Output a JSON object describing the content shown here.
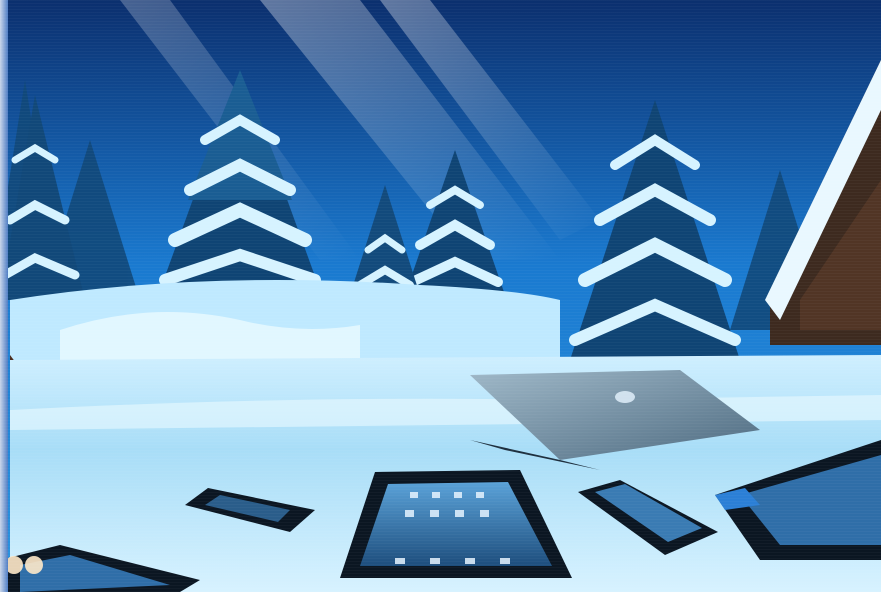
{
  "scene": {
    "subject": "snowy-forest-with-devices",
    "devices": [
      "laptop",
      "tablet",
      "phone-small",
      "phone-large",
      "tablet-right",
      "tablet-left"
    ],
    "palette": {
      "sky_top": "#0b2f6e",
      "sky_mid": "#1670c7",
      "snow": "#bfe9ff",
      "snow_highlight": "#eafaff",
      "tree_dark": "#0f3f6f",
      "tree_snow": "#cfefff",
      "device_dark": "#0b1622",
      "device_screen": "#2f6ea8"
    }
  }
}
